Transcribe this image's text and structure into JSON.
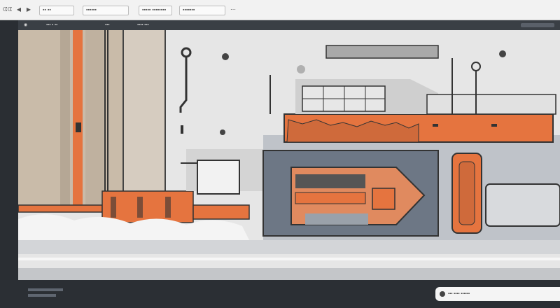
{
  "topbar": {
    "app_label": "ᗧᗧ",
    "menu_items": [
      "▪▪ ▪▪",
      "▪▪▪▪▪▪",
      "▪▪▪▪▪ ▪▪▪▪▪▪▪▪",
      "▪▪▪▪▪▪▪",
      "▪▪▪▪▪▪▪▪▪"
    ]
  },
  "toolbar": {
    "labels": [
      "▪▪▪ ▪ ▪▪",
      "▪▪▪",
      "▪▪▪▪ ▪▪▪"
    ]
  },
  "status": {
    "text": "▪▪▪ ▪▪▪▪ ▪▪▪▪▪▪"
  },
  "colors": {
    "accent_orange": "#e5743f",
    "panel_beige": "#c9bba9",
    "slate": "#6d7785",
    "dark": "#2b2f34",
    "canvas_bg": "#e6e6e6"
  }
}
